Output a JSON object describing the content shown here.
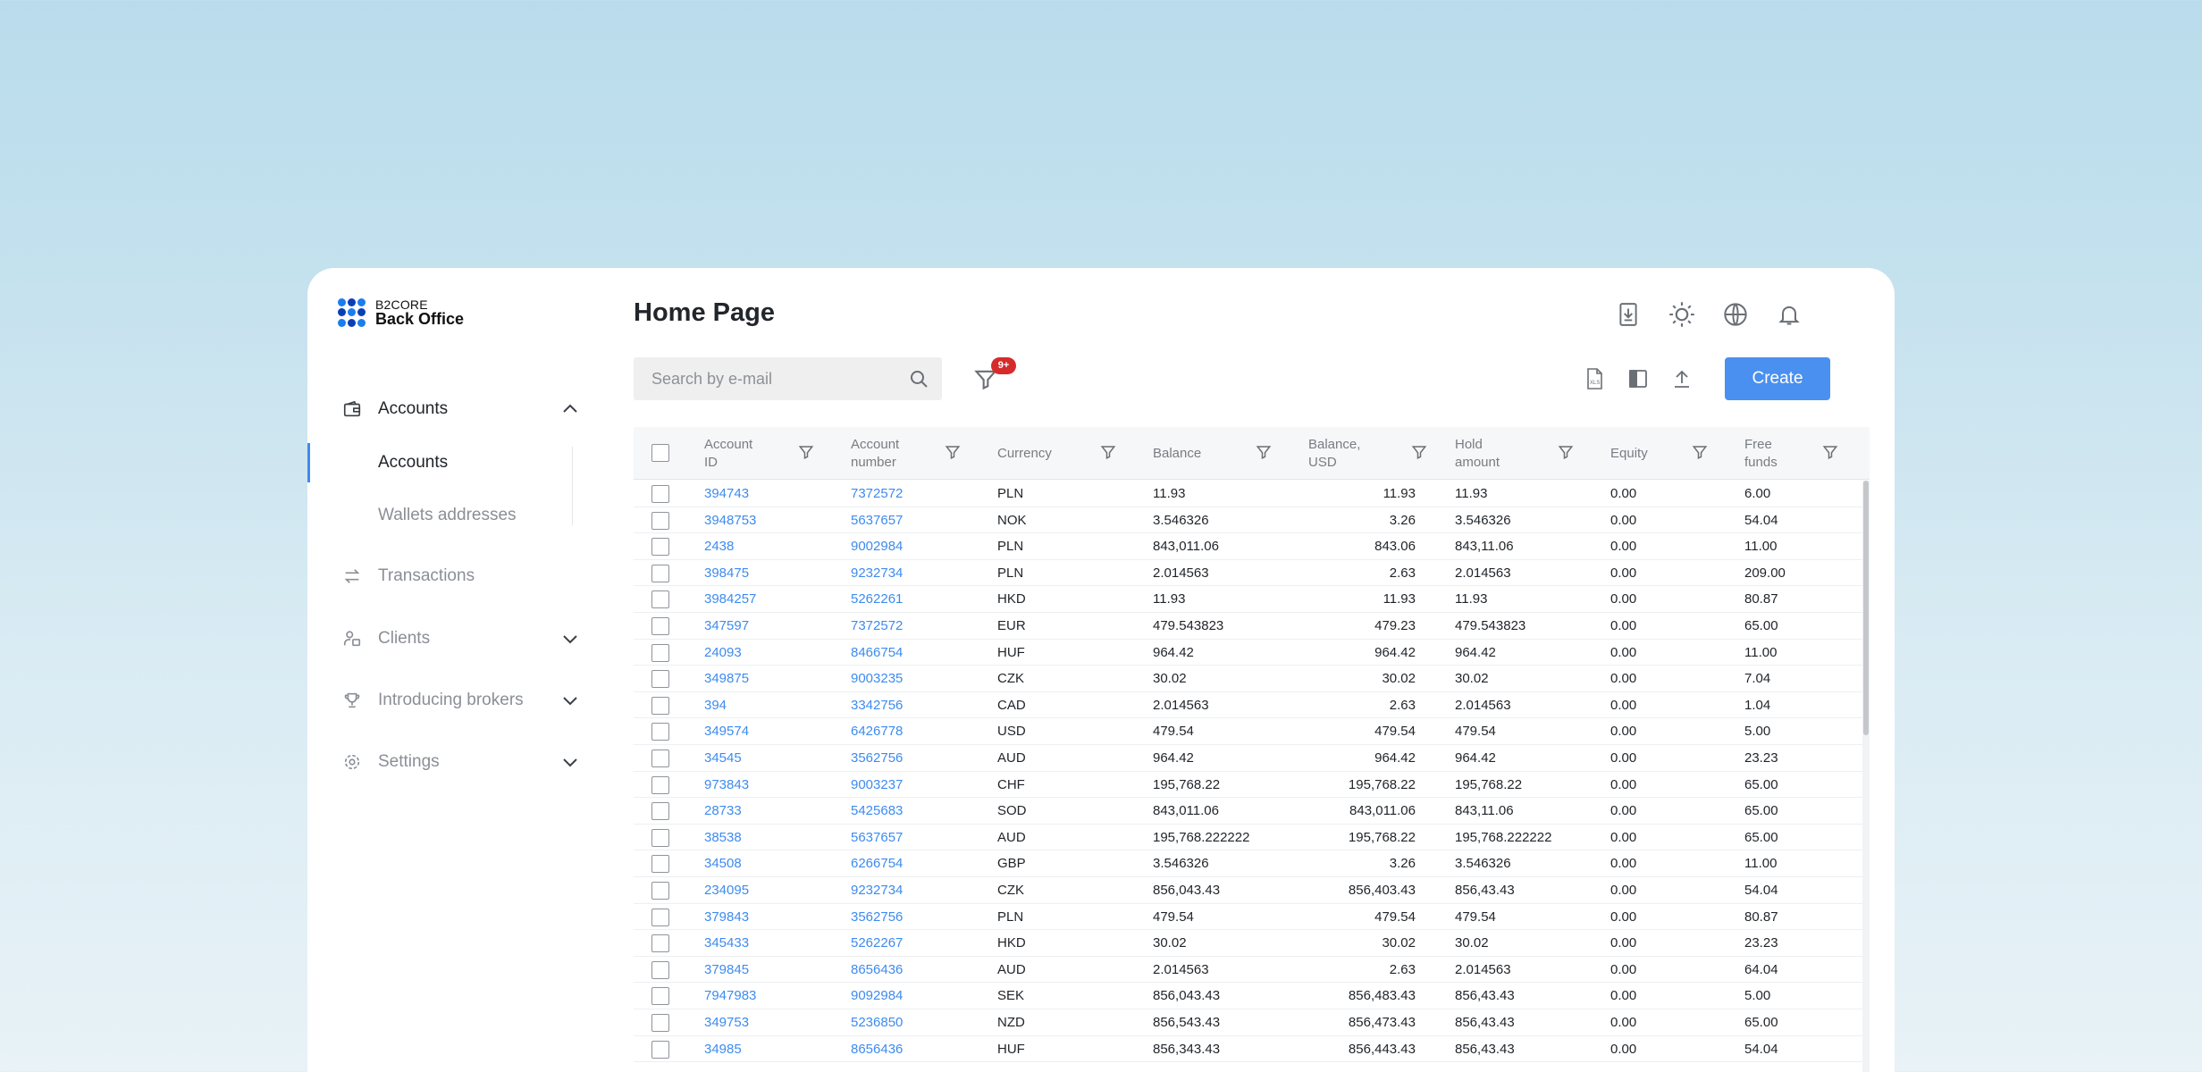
{
  "logo": {
    "top": "B2CORE",
    "bottom": "Back Office"
  },
  "sidebar": {
    "items": [
      {
        "label": "Accounts",
        "icon": "wallet-icon"
      },
      {
        "label": "Transactions",
        "icon": "arrows-swap-icon"
      },
      {
        "label": "Clients",
        "icon": "users-icon"
      },
      {
        "label": "Introducing brokers",
        "icon": "trophy-icon"
      },
      {
        "label": "Settings",
        "icon": "gear-icon"
      }
    ],
    "subitems": [
      {
        "label": "Accounts"
      },
      {
        "label": "Wallets addresses"
      }
    ]
  },
  "header": {
    "title": "Home Page",
    "icons": [
      "download-doc-icon",
      "sun-icon",
      "globe-icon",
      "bell-icon"
    ]
  },
  "toolbar": {
    "search_placeholder": "Search by e-mail",
    "filter_badge": "9+",
    "create_label": "Create",
    "icons": [
      "xls-export-icon",
      "columns-icon",
      "upload-icon"
    ]
  },
  "colors": {
    "accent": "#4a90f0",
    "link": "#3d8bf0",
    "badge": "#d62b2b"
  },
  "table": {
    "columns": [
      {
        "line1": "Account",
        "line2": "ID"
      },
      {
        "line1": "Account",
        "line2": "number"
      },
      {
        "line1": "Currency",
        "line2": ""
      },
      {
        "line1": "Balance",
        "line2": ""
      },
      {
        "line1": "Balance,",
        "line2": "USD"
      },
      {
        "line1": "Hold",
        "line2": "amount"
      },
      {
        "line1": "Equity",
        "line2": ""
      },
      {
        "line1": "Free",
        "line2": "funds"
      }
    ],
    "rows": [
      [
        "394743",
        "7372572",
        "PLN",
        "11.93",
        "11.93",
        "11.93",
        "0.00",
        "6.00"
      ],
      [
        "3948753",
        "5637657",
        "NOK",
        "3.546326",
        "3.26",
        "3.546326",
        "0.00",
        "54.04"
      ],
      [
        "2438",
        "9002984",
        "PLN",
        "843,011.06",
        "843.06",
        "843,11.06",
        "0.00",
        "11.00"
      ],
      [
        "398475",
        "9232734",
        "PLN",
        "2.014563",
        "2.63",
        "2.014563",
        "0.00",
        "209.00"
      ],
      [
        "3984257",
        "5262261",
        "HKD",
        "11.93",
        "11.93",
        "11.93",
        "0.00",
        "80.87"
      ],
      [
        "347597",
        "7372572",
        "EUR",
        "479.543823",
        "479.23",
        "479.543823",
        "0.00",
        "65.00"
      ],
      [
        "24093",
        "8466754",
        "HUF",
        "964.42",
        "964.42",
        "964.42",
        "0.00",
        "11.00"
      ],
      [
        "349875",
        "9003235",
        "CZK",
        "30.02",
        "30.02",
        "30.02",
        "0.00",
        "7.04"
      ],
      [
        "394",
        "3342756",
        "CAD",
        "2.014563",
        "2.63",
        "2.014563",
        "0.00",
        "1.04"
      ],
      [
        "349574",
        "6426778",
        "USD",
        "479.54",
        "479.54",
        "479.54",
        "0.00",
        "5.00"
      ],
      [
        "34545",
        "3562756",
        "AUD",
        "964.42",
        "964.42",
        "964.42",
        "0.00",
        "23.23"
      ],
      [
        "973843",
        "9003237",
        "CHF",
        "195,768.22",
        "195,768.22",
        "195,768.22",
        "0.00",
        "65.00"
      ],
      [
        "28733",
        "5425683",
        "SOD",
        "843,011.06",
        "843,011.06",
        "843,11.06",
        "0.00",
        "65.00"
      ],
      [
        "38538",
        "5637657",
        "AUD",
        "195,768.222222",
        "195,768.22",
        "195,768.222222",
        "0.00",
        "65.00"
      ],
      [
        "34508",
        "6266754",
        "GBP",
        "3.546326",
        "3.26",
        "3.546326",
        "0.00",
        "11.00"
      ],
      [
        "234095",
        "9232734",
        "CZK",
        "856,043.43",
        "856,403.43",
        "856,43.43",
        "0.00",
        "54.04"
      ],
      [
        "379843",
        "3562756",
        "PLN",
        "479.54",
        "479.54",
        "479.54",
        "0.00",
        "80.87"
      ],
      [
        "345433",
        "5262267",
        "HKD",
        "30.02",
        "30.02",
        "30.02",
        "0.00",
        "23.23"
      ],
      [
        "379845",
        "8656436",
        "AUD",
        "2.014563",
        "2.63",
        "2.014563",
        "0.00",
        "64.04"
      ],
      [
        "7947983",
        "9092984",
        "SEK",
        "856,043.43",
        "856,483.43",
        "856,43.43",
        "0.00",
        "5.00"
      ],
      [
        "349753",
        "5236850",
        "NZD",
        "856,543.43",
        "856,473.43",
        "856,43.43",
        "0.00",
        "65.00"
      ],
      [
        "34985",
        "8656436",
        "HUF",
        "856,343.43",
        "856,443.43",
        "856,43.43",
        "0.00",
        "54.04"
      ]
    ]
  }
}
